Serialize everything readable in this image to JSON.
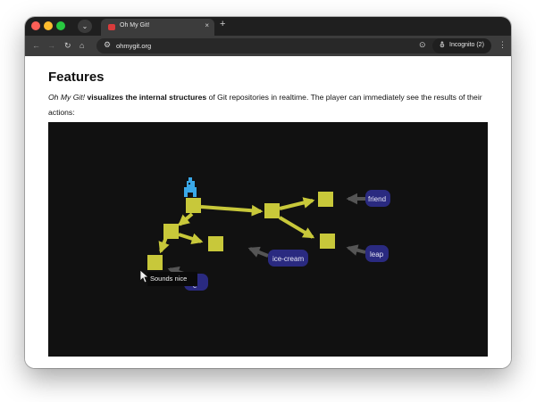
{
  "browser": {
    "tab_title": "Oh My Git!",
    "tab_close": "×",
    "new_tab": "+",
    "dropdown": "⌄",
    "url": "ohmygit.org",
    "incognito_label": "Incognito (2)",
    "icons": {
      "back": "←",
      "forward": "→",
      "reload": "↻",
      "home": "⌂",
      "site_settings": "⚙",
      "bookmark": "☆",
      "extension": "⊙",
      "incognito": "⛢",
      "menu": "⋮"
    }
  },
  "page": {
    "heading": "Features",
    "para_italic": "Oh My Git!",
    "para_bold": "visualizes the internal structures",
    "para_rest": " of Git repositories in realtime. The player can immediately see the results of their actions:"
  },
  "game": {
    "labels": {
      "friend": "friend",
      "leap": "leap",
      "ice_cream": "ice-cream",
      "hidden_partial": "c"
    },
    "tooltip": "Sounds nice",
    "colors": {
      "background": "#111111",
      "commit": "#c8c83a",
      "ref": "#2a2a80",
      "ref_arrow": "#555555",
      "player": "#3aa8e8"
    }
  }
}
